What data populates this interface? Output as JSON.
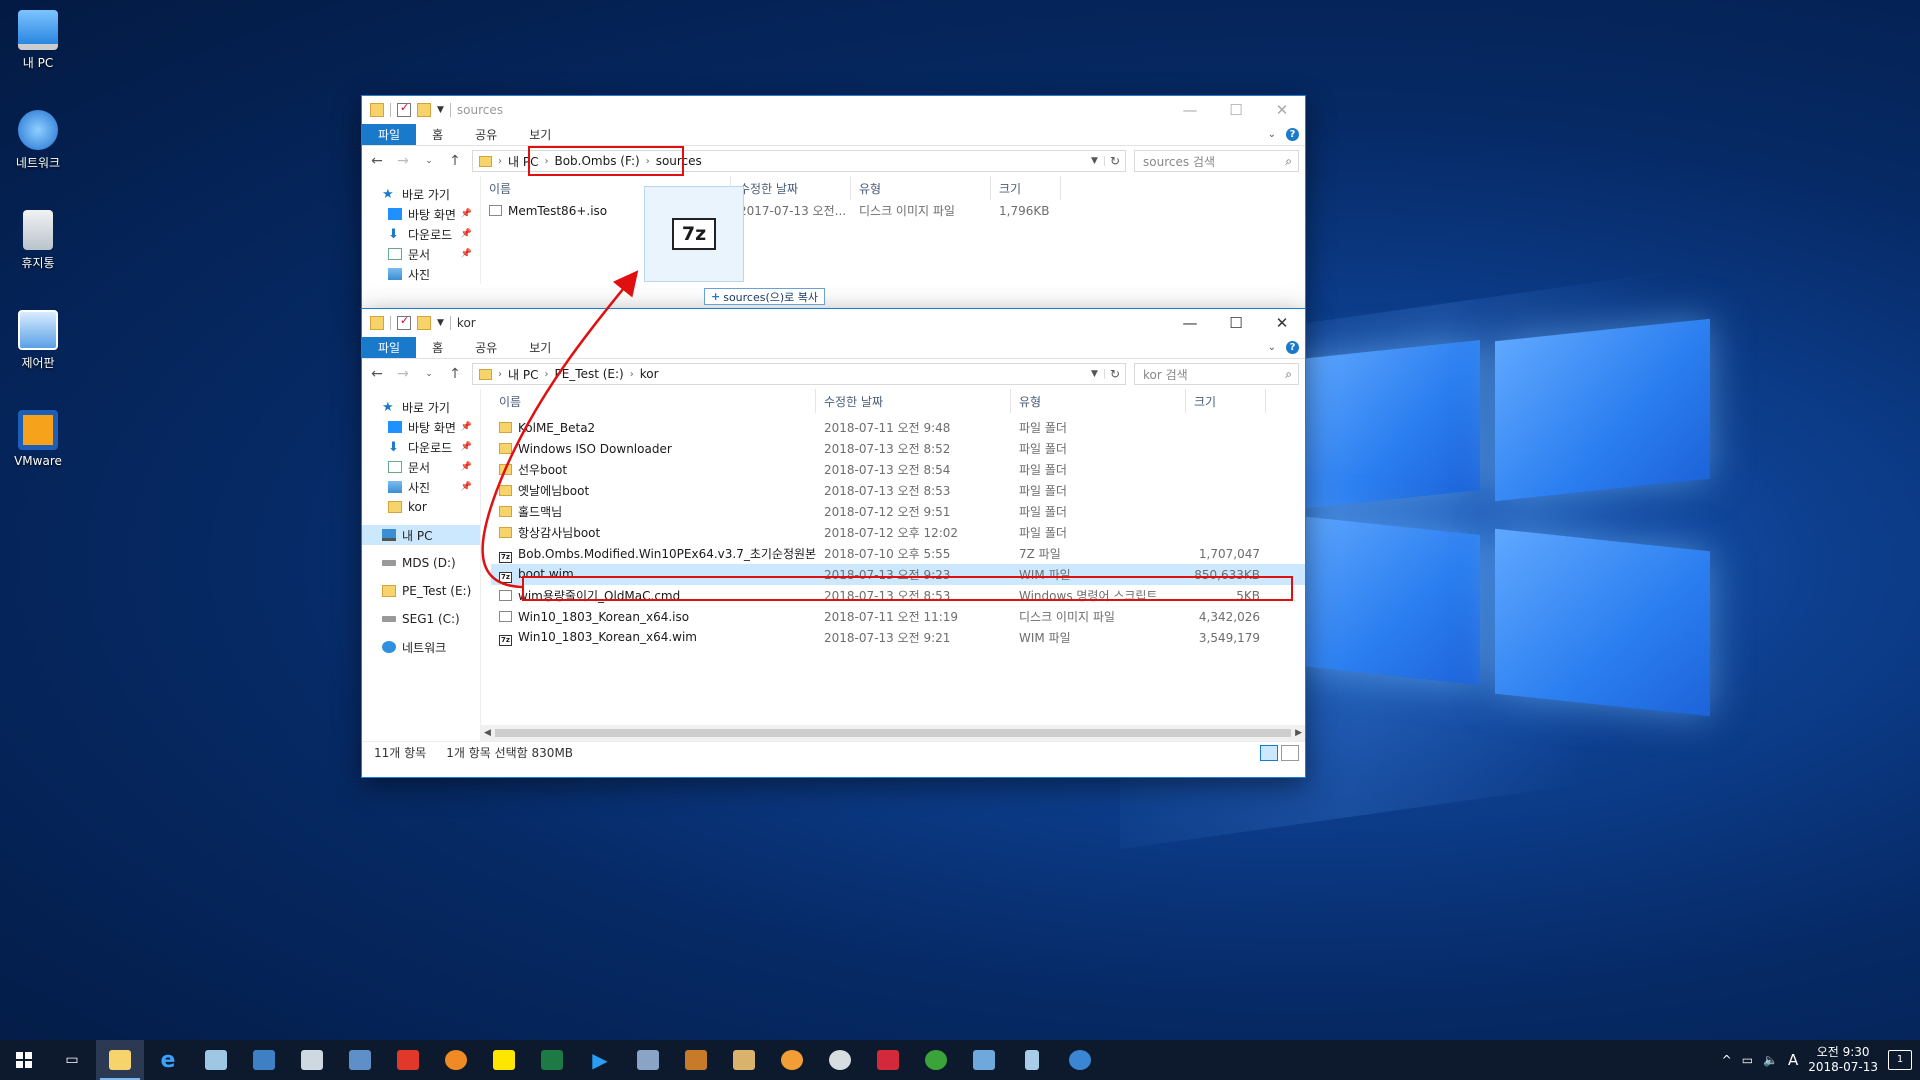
{
  "desktop": {
    "icons": [
      {
        "label": "내 PC"
      },
      {
        "label": "네트워크"
      },
      {
        "label": "휴지통"
      },
      {
        "label": "제어판"
      },
      {
        "label": "VMware"
      }
    ]
  },
  "win_sources": {
    "title": "sources",
    "ribbon": {
      "file": "파일",
      "home": "홈",
      "share": "공유",
      "view": "보기"
    },
    "address": {
      "pc": "내 PC",
      "drive": "Bob.Ombs (F:)",
      "folder": "sources"
    },
    "search_placeholder": "sources 검색",
    "nav": [
      {
        "label": "바로 가기"
      },
      {
        "label": "바탕 화면"
      },
      {
        "label": "다운로드"
      },
      {
        "label": "문서"
      },
      {
        "label": "사진"
      }
    ],
    "columns": {
      "name": "이름",
      "date": "수정한 날짜",
      "type": "유형",
      "size": "크기"
    },
    "files": [
      {
        "name": "MemTest86+.iso",
        "date": "2017-07-13 오전...",
        "type": "디스크 이미지 파일",
        "size": "1,796KB"
      }
    ],
    "drag_tip": "sources(으)로 복사",
    "drag_icon": "7z"
  },
  "win_kor": {
    "title": "kor",
    "ribbon": {
      "file": "파일",
      "home": "홈",
      "share": "공유",
      "view": "보기"
    },
    "address": {
      "pc": "내 PC",
      "drive": "PE_Test (E:)",
      "folder": "kor"
    },
    "search_placeholder": "kor 검색",
    "nav": [
      {
        "label": "바로 가기"
      },
      {
        "label": "바탕 화면"
      },
      {
        "label": "다운로드"
      },
      {
        "label": "문서"
      },
      {
        "label": "사진"
      },
      {
        "label": "kor"
      },
      {
        "label": "내 PC"
      },
      {
        "label": "MDS (D:)"
      },
      {
        "label": "PE_Test (E:)"
      },
      {
        "label": "SEG1 (C:)"
      },
      {
        "label": "네트워크"
      }
    ],
    "columns": {
      "name": "이름",
      "date": "수정한 날짜",
      "type": "유형",
      "size": "크기"
    },
    "files": [
      {
        "name": "KolME_Beta2",
        "date": "2018-07-11 오전 9:48",
        "type": "파일 폴더",
        "size": "",
        "icon": "folder"
      },
      {
        "name": "Windows ISO Downloader",
        "date": "2018-07-13 오전 8:52",
        "type": "파일 폴더",
        "size": "",
        "icon": "folder"
      },
      {
        "name": "선우boot",
        "date": "2018-07-13 오전 8:54",
        "type": "파일 폴더",
        "size": "",
        "icon": "folder"
      },
      {
        "name": "옛날에님boot",
        "date": "2018-07-13 오전 8:53",
        "type": "파일 폴더",
        "size": "",
        "icon": "folder"
      },
      {
        "name": "홀드맥님",
        "date": "2018-07-12 오전 9:51",
        "type": "파일 폴더",
        "size": "",
        "icon": "folder"
      },
      {
        "name": "항상감사님boot",
        "date": "2018-07-12 오후 12:02",
        "type": "파일 폴더",
        "size": "",
        "icon": "folder"
      },
      {
        "name": "Bob.Ombs.Modified.Win10PEx64.v3.7_초기순정원본.",
        "date": "2018-07-10 오후 5:55",
        "type": "7Z 파일",
        "size": "1,707,047",
        "icon": "z7"
      },
      {
        "name": "boot.wim",
        "date": "2018-07-13 오전 9:23",
        "type": "WIM 파일",
        "size": "850,633KB",
        "icon": "z7",
        "selected": true
      },
      {
        "name": "wim용량줄이기_OldMaC.cmd",
        "date": "2018-07-13 오전 8:53",
        "type": "Windows 명령어 스크립트",
        "size": "5KB",
        "icon": "file"
      },
      {
        "name": "Win10_1803_Korean_x64.iso",
        "date": "2018-07-11 오전 11:19",
        "type": "디스크 이미지 파일",
        "size": "4,342,026",
        "icon": "file"
      },
      {
        "name": "Win10_1803_Korean_x64.wim",
        "date": "2018-07-13 오전 9:21",
        "type": "WIM 파일",
        "size": "3,549,179",
        "icon": "z7"
      }
    ],
    "status": {
      "count": "11개 항목",
      "selected": "1개 항목 선택함 830MB"
    }
  },
  "taskbar": {
    "tray_lang": "A",
    "clock_time": "오전 9:30",
    "clock_date": "2018-07-13",
    "notification_count": "1"
  },
  "colors": {
    "accent": "#1979ca",
    "highlight": "#e01010",
    "selection": "#cce8ff"
  }
}
